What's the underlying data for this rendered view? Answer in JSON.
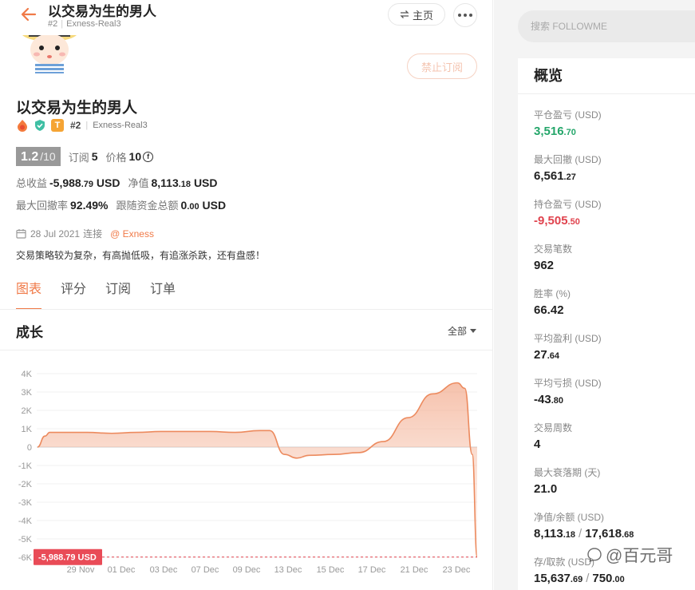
{
  "header": {
    "title": "以交易为生的男人",
    "rank": "#2",
    "account": "Exness-Real3",
    "home_label": "主页"
  },
  "profile": {
    "name": "以交易为生的男人",
    "badge_letter": "T",
    "rank": "#2",
    "account": "Exness-Real3",
    "unsubscribe_label": "禁止订阅",
    "score": "1.2",
    "score_max": "/10",
    "subs_label": "订阅",
    "subs_value": "5",
    "price_label": "价格",
    "price_value": "10",
    "total_profit_label": "总收益",
    "total_profit_main": "-5,988",
    "total_profit_dec": ".79",
    "total_profit_unit": "USD",
    "equity_label": "净值",
    "equity_main": "8,113",
    "equity_dec": ".18",
    "equity_unit": "USD",
    "max_drawdown_label": "最大回撤率",
    "max_drawdown_value": "92.49%",
    "follow_funds_label": "跟随资金总额",
    "follow_funds_main": "0",
    "follow_funds_dec": ".00",
    "follow_funds_unit": "USD",
    "connected_date": "28 Jul 2021",
    "connected_label": "连接",
    "broker": "@ Exness",
    "description": "交易策略较为复杂，有高抛低吸，有追涨杀跌，还有盘感！"
  },
  "tabs": [
    {
      "label": "图表",
      "active": true
    },
    {
      "label": "评分",
      "active": false
    },
    {
      "label": "订阅",
      "active": false
    },
    {
      "label": "订单",
      "active": false
    }
  ],
  "growth": {
    "title": "成长",
    "period": "全部"
  },
  "chart_data": {
    "type": "area",
    "title": "成长",
    "y_ticks": [
      "4K",
      "3K",
      "2K",
      "1K",
      "0",
      "-1K",
      "-2K",
      "-3K",
      "-4K",
      "-5K",
      "-6K"
    ],
    "x_ticks": [
      "29 Nov",
      "01 Dec",
      "03 Dec",
      "07 Dec",
      "09 Dec",
      "13 Dec",
      "15 Dec",
      "17 Dec",
      "21 Dec",
      "23 Dec"
    ],
    "ylim": [
      -6000,
      4000
    ],
    "last_value_label": "-5,988.79 USD",
    "series_color": "#ec8a5e",
    "points": [
      [
        0,
        0
      ],
      [
        0.3,
        600
      ],
      [
        0.5,
        800
      ],
      [
        1,
        800
      ],
      [
        2,
        800
      ],
      [
        3,
        750
      ],
      [
        4,
        800
      ],
      [
        5,
        850
      ],
      [
        6,
        850
      ],
      [
        7,
        850
      ],
      [
        8,
        800
      ],
      [
        9,
        900
      ],
      [
        9.4,
        900
      ],
      [
        10,
        -400
      ],
      [
        10.5,
        -600
      ],
      [
        11,
        -450
      ],
      [
        12,
        -400
      ],
      [
        13,
        -300
      ],
      [
        14,
        300
      ],
      [
        15,
        1600
      ],
      [
        16,
        2900
      ],
      [
        17,
        3500
      ],
      [
        17.3,
        3200
      ],
      [
        17.6,
        -400
      ],
      [
        17.8,
        -5989
      ]
    ]
  },
  "search": {
    "placeholder": "搜索 FOLLOWME"
  },
  "overview": {
    "title": "概览",
    "items": [
      {
        "label": "平仓盈亏 (USD)",
        "main": "3,516",
        "dec": ".70",
        "color": "green"
      },
      {
        "label": "最大回撤 (USD)",
        "main": "6,561",
        "dec": ".27",
        "color": "normal"
      },
      {
        "label": "持仓盈亏 (USD)",
        "main": "-9,505",
        "dec": ".50",
        "color": "red"
      },
      {
        "label": "交易笔数",
        "main": "962",
        "dec": "",
        "color": "normal"
      },
      {
        "label": "胜率 (%)",
        "main": "66.42",
        "dec": "",
        "color": "normal"
      },
      {
        "label": "平均盈利 (USD)",
        "main": "27",
        "dec": ".64",
        "color": "normal"
      },
      {
        "label": "平均亏损 (USD)",
        "main": "-43",
        "dec": ".80",
        "color": "normal"
      },
      {
        "label": "交易周数",
        "main": "4",
        "dec": "",
        "color": "normal"
      },
      {
        "label": "最大衰落期 (天)",
        "main": "21.0",
        "dec": "",
        "color": "normal"
      },
      {
        "label": "净值/余额 (USD)",
        "main": "8,113",
        "dec": ".18",
        "main2": "17,618",
        "dec2": ".68",
        "color": "normal"
      },
      {
        "label": "存/取款 (USD)",
        "main": "15,637",
        "dec": ".69",
        "main2": "750",
        "dec2": ".00",
        "color": "normal"
      }
    ]
  },
  "watermark": "@百元哥"
}
